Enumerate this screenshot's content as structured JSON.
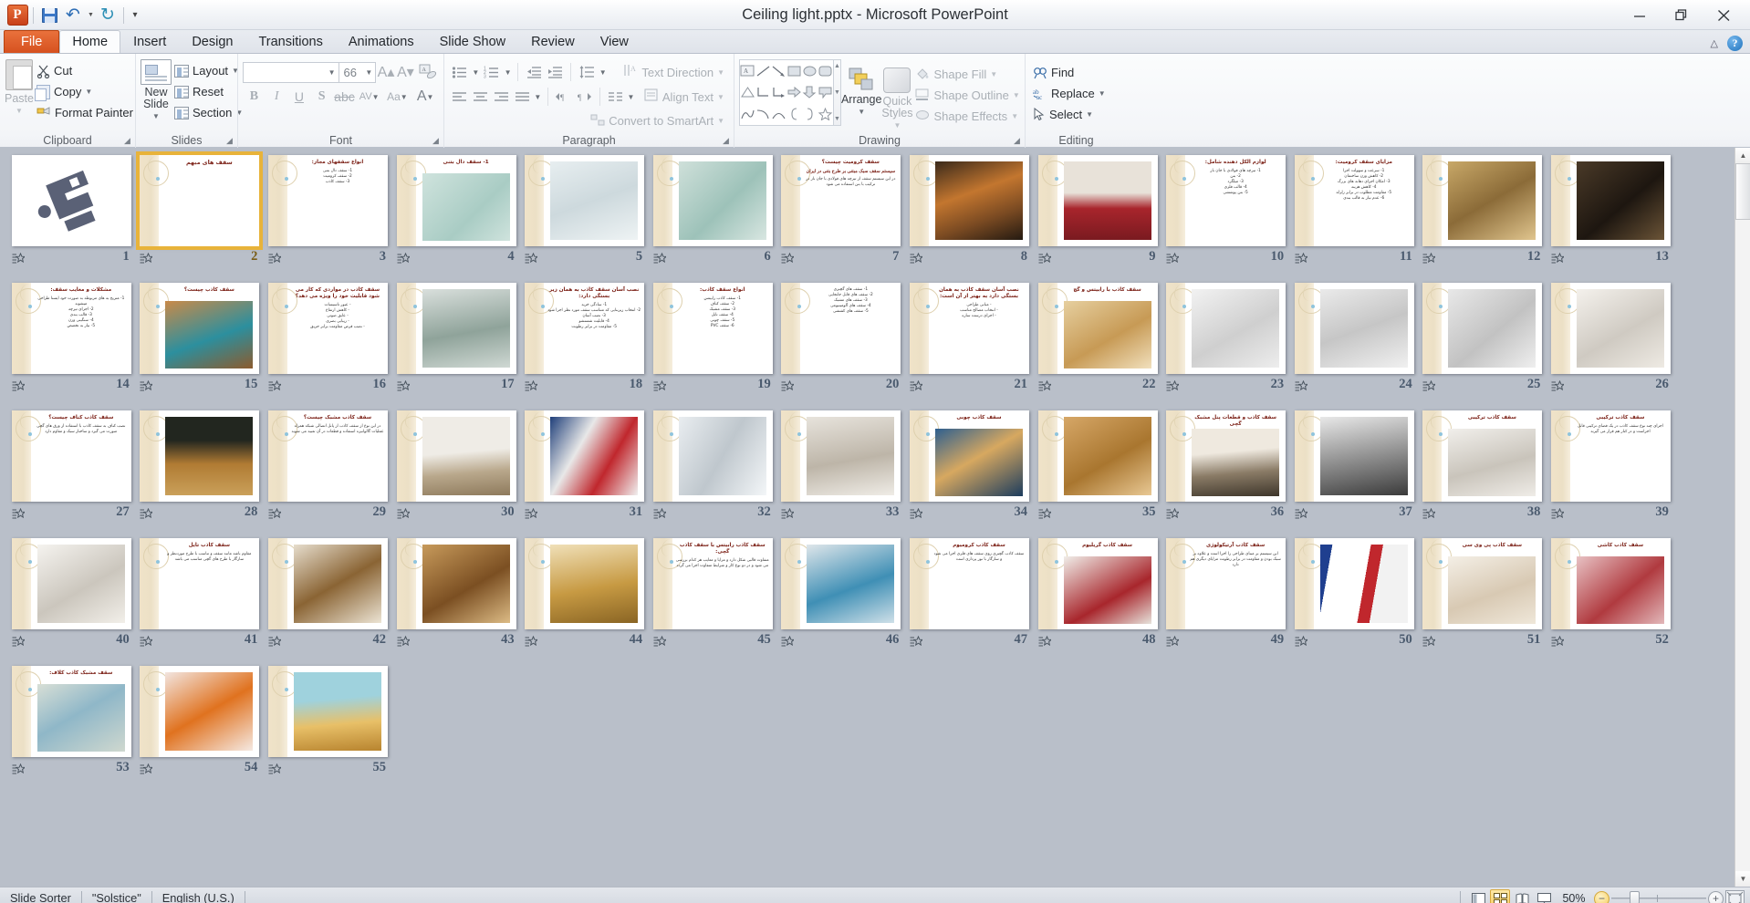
{
  "titlebar": {
    "document_title": "Ceiling light.pptx  -  Microsoft PowerPoint",
    "app_logo": "powerpoint-logo",
    "qat": [
      {
        "name": "save-icon",
        "label": "Save"
      },
      {
        "name": "undo-icon",
        "label": "Undo"
      },
      {
        "name": "redo-icon",
        "label": "Redo"
      },
      {
        "name": "customize-qat-icon",
        "label": "Customize Quick Access Toolbar"
      }
    ],
    "window": {
      "minimize": "—",
      "restore": "❐",
      "close": "✕"
    }
  },
  "tabs": [
    {
      "label": "File",
      "active": false,
      "kind": "file"
    },
    {
      "label": "Home",
      "active": true
    },
    {
      "label": "Insert",
      "active": false
    },
    {
      "label": "Design",
      "active": false
    },
    {
      "label": "Transitions",
      "active": false
    },
    {
      "label": "Animations",
      "active": false
    },
    {
      "label": "Slide Show",
      "active": false
    },
    {
      "label": "Review",
      "active": false
    },
    {
      "label": "View",
      "active": false
    }
  ],
  "help": {
    "collapse_ribbon": "collapse-ribbon-icon",
    "help_label": "?"
  },
  "ribbon": {
    "groups": [
      {
        "name": "clipboard",
        "label": "Clipboard",
        "paste_label": "Paste",
        "items": [
          {
            "label": "Cut",
            "icon": "scissors-icon",
            "dim": false,
            "caret": false
          },
          {
            "label": "Copy",
            "icon": "copy-icon",
            "dim": false,
            "caret": true
          },
          {
            "label": "Format Painter",
            "icon": "format-painter-icon",
            "dim": false,
            "caret": false
          }
        ]
      },
      {
        "name": "slides",
        "label": "Slides",
        "new_slide_label": "New\nSlide",
        "new_slide_line1": "New",
        "new_slide_line2": "Slide",
        "items": [
          {
            "label": "Layout",
            "icon": "layout-icon",
            "caret": true
          },
          {
            "label": "Reset",
            "icon": "reset-icon",
            "caret": false
          },
          {
            "label": "Section",
            "icon": "section-icon",
            "caret": true
          }
        ]
      },
      {
        "name": "font",
        "label": "Font",
        "font_name_value": "",
        "font_size_value": "66",
        "buttons": [
          "bold",
          "italic",
          "underline",
          "shadow",
          "strikethrough",
          "character-spacing",
          "change-case",
          "font-color",
          "grow-font",
          "shrink-font",
          "clear-formatting"
        ]
      },
      {
        "name": "paragraph",
        "label": "Paragraph",
        "items": [
          {
            "label": "Text Direction",
            "icon": "text-direction-icon",
            "dim": true,
            "caret": true
          },
          {
            "label": "Align Text",
            "icon": "align-text-icon",
            "dim": true,
            "caret": true
          },
          {
            "label": "Convert to SmartArt",
            "icon": "smartart-icon",
            "dim": true,
            "caret": true
          }
        ]
      },
      {
        "name": "drawing",
        "label": "Drawing",
        "arrange_label": "Arrange",
        "quick_styles_line1": "Quick",
        "quick_styles_line2": "Styles",
        "items": [
          {
            "label": "Shape Fill",
            "icon": "shape-fill-icon",
            "dim": true,
            "caret": true
          },
          {
            "label": "Shape Outline",
            "icon": "shape-outline-icon",
            "dim": true,
            "caret": true
          },
          {
            "label": "Shape Effects",
            "icon": "shape-effects-icon",
            "dim": true,
            "caret": true
          }
        ]
      },
      {
        "name": "editing",
        "label": "Editing",
        "items": [
          {
            "label": "Find",
            "icon": "find-icon",
            "dim": false,
            "caret": false
          },
          {
            "label": "Replace",
            "icon": "replace-icon",
            "dim": false,
            "caret": true
          },
          {
            "label": "Select",
            "icon": "select-icon",
            "dim": false,
            "caret": true
          }
        ]
      }
    ]
  },
  "statusbar": {
    "view_name": "Slide Sorter",
    "theme_name": "\"Solstice\"",
    "language": "English (U.S.)",
    "zoom_level": "50%",
    "views": [
      {
        "name": "normal-view-button",
        "active": false
      },
      {
        "name": "slide-sorter-view-button",
        "active": true
      },
      {
        "name": "reading-view-button",
        "active": false
      },
      {
        "name": "slide-show-button",
        "active": false
      }
    ],
    "zoom_out": "−",
    "zoom_in": "+",
    "fit_to_window": "fit-slide-to-window-icon"
  },
  "sorter": {
    "selected_slide": 2,
    "columns": 11,
    "slides": [
      {
        "n": 1,
        "kind": "image",
        "no_band": true,
        "img": "logo",
        "title": ""
      },
      {
        "n": 2,
        "kind": "title",
        "title": "سقف های مبهم",
        "body": []
      },
      {
        "n": 3,
        "kind": "list",
        "title": "انواع سقفهای مجاز:",
        "body": [
          "1- سقف دال بتنی",
          "2- سقف کرومیت",
          "3- سقف کاذب"
        ]
      },
      {
        "n": 4,
        "kind": "image",
        "title": "1- سقف دال بتنی",
        "img": "diagram-green"
      },
      {
        "n": 5,
        "kind": "image",
        "title": "",
        "img": "diagram-blue"
      },
      {
        "n": 6,
        "kind": "image",
        "title": "",
        "img": "diagram-teal"
      },
      {
        "n": 7,
        "kind": "text",
        "title": "سقف کرومیت چیست؟",
        "subtitle": "سیستم سقف سبک مبتنی بر طرح بتنی در ایران",
        "body": [
          "در این سیستم سقف از تیرچه های فولادی با جان باز در ترکیب با بتن استفاده می شود"
        ]
      },
      {
        "n": 8,
        "kind": "image",
        "title": "",
        "img": "corridor-wood"
      },
      {
        "n": 9,
        "kind": "image",
        "title": "",
        "img": "hall-red"
      },
      {
        "n": 10,
        "kind": "list",
        "title": "لوازم الکل دهنده شامل:",
        "body": [
          "1- تیرچه های فولادی با جان باز",
          "2- بتن",
          "3- میلگرد",
          "4- قالب فلزی",
          "5- بتن پوششی"
        ]
      },
      {
        "n": 11,
        "kind": "list",
        "title": "مزایای سقف کرومیت:",
        "body": [
          "1- سرعت و سهولت اجرا",
          "2- کاهش وزن ساختمان",
          "3- امکان اجرای دهانه های بزرگ",
          "4- کاهش هزینه",
          "5- مقاومت مطلوب در برابر زلزله",
          "6- عدم نیاز به قالب بندی"
        ]
      },
      {
        "n": 12,
        "kind": "image",
        "title": "",
        "img": "ceiling-gold"
      },
      {
        "n": 13,
        "kind": "image",
        "title": "",
        "img": "ceiling-dark"
      },
      {
        "n": 14,
        "kind": "list",
        "title": "مشکلات و معایب سقف:",
        "body": [
          "1- متریح به های مربوطه به صورت خود ایستا طراحی میشوند",
          "2- اجرای تیرچه",
          "3- قالب بندی",
          "4- سنگینی وزن",
          "5- نیاز به تخصص"
        ]
      },
      {
        "n": 15,
        "kind": "image",
        "title": "سقف کاذب چیست؟",
        "img": "ceiling-teal-light"
      },
      {
        "n": 16,
        "kind": "text",
        "title": "سقف کاذب در مواردی که کار می شود قابلیت خود را ویژه می دهد؟",
        "body": [
          "- عبور تاسیسات",
          "- کاهش ارتفاع",
          "- عایق صوتی",
          "- زیبایی بصری",
          "- نصب قرص مقاومت برابر حریق"
        ]
      },
      {
        "n": 17,
        "kind": "image",
        "title": "",
        "img": "room-glass"
      },
      {
        "n": 18,
        "kind": "text",
        "title": "نصب آسان سقف کاذب به همان زیر بستگی دارد:",
        "body": [
          "1- سادگی خرید",
          "2- انتخاب زیربنایی که متناسب سقف مورد نظر اجرا شود",
          "3- نصب آسان",
          "4- قابلیت شستشو",
          "5- مقاومت در برابر رطوبت"
        ]
      },
      {
        "n": 19,
        "kind": "list",
        "title": "انواع سقف کاذب:",
        "body": [
          "1- سقف کاذب رابیتس",
          "2- سقف کناف",
          "3- سقف مشبک",
          "4- سقف تایل",
          "5- سقف چوبی",
          "6- سقف PVC"
        ]
      },
      {
        "n": 20,
        "kind": "list",
        "title": "",
        "body": [
          "1- سقف های گچبری",
          "2- سقف های قابل جابجایی",
          "3- سقف های مشبک",
          "4- سقف های آلومینیومی",
          "5- سقف های کششی"
        ]
      },
      {
        "n": 21,
        "kind": "text",
        "title": "نصب آسان سقف کاذب به همان بستگی دارد به بهتر از آن است:",
        "body": [
          "- مبانی طراحی",
          "- انتخاب مصالح مناسب",
          "- اجرای درست سازه"
        ]
      },
      {
        "n": 22,
        "kind": "image",
        "title": "سقف کاذب با رابیتس و گچ",
        "img": "ceiling-curve-warm"
      },
      {
        "n": 23,
        "kind": "image",
        "title": "",
        "img": "ceiling-white-1"
      },
      {
        "n": 24,
        "kind": "image",
        "title": "",
        "img": "ceiling-white-2"
      },
      {
        "n": 25,
        "kind": "image",
        "title": "",
        "img": "ceiling-white-3"
      },
      {
        "n": 26,
        "kind": "image",
        "title": "",
        "img": "ceiling-white-4"
      },
      {
        "n": 27,
        "kind": "text",
        "title": "سقف کاذب کناف چیست؟",
        "body": [
          "نصب کناف به سقف کاذب با استفاده از ورق های گچی صورت می گیرد و ساختار سبک و مقاوم دارد"
        ]
      },
      {
        "n": 28,
        "kind": "image",
        "title": "",
        "img": "hall-wood-lights"
      },
      {
        "n": 29,
        "kind": "text",
        "title": "سقف کاذب مشبک چیست؟",
        "body": [
          "در این نوع از سقف کاذب از پانل اتصالی شبکه همراه عملیات گالوانیزه استفاده و قطعات در آن تعبیه می شوند"
        ]
      },
      {
        "n": 30,
        "kind": "image",
        "title": "",
        "img": "hall-conference"
      },
      {
        "n": 31,
        "kind": "image",
        "title": "",
        "img": "panels-color"
      },
      {
        "n": 32,
        "kind": "image",
        "title": "",
        "img": "panels-white"
      },
      {
        "n": 33,
        "kind": "image",
        "title": "",
        "img": "corridor-light"
      },
      {
        "n": 34,
        "kind": "image",
        "title": "سقف کاذب چوبی",
        "img": "office-blue"
      },
      {
        "n": 35,
        "kind": "image",
        "title": "",
        "img": "ceiling-wood-slat"
      },
      {
        "n": 36,
        "kind": "image",
        "title": "سقف کاذب و قطعات پنل مشبک گچی",
        "img": "hall-crowd"
      },
      {
        "n": 37,
        "kind": "image",
        "title": "",
        "img": "ceiling-gray-dark"
      },
      {
        "n": 38,
        "kind": "image",
        "title": "سقف کاذب ترکیبی",
        "img": "lobby-white"
      },
      {
        "n": 39,
        "kind": "text",
        "title": "سقف کاذب ترکیبی",
        "body": [
          "اجرای چند نوع سقف کاذب در یک فضای ترکیبی قابل اجراست و در کنار هم قرار می گیرند"
        ]
      },
      {
        "n": 40,
        "kind": "image",
        "title": "",
        "img": "ceiling-white-dome"
      },
      {
        "n": 41,
        "kind": "text",
        "title": "سقف کاذب تایل",
        "body": [
          "مقاوم باشد مانند سقف و تناسب با طرح موردنظر و سازگار با طرح های گچی مناسب می باشد"
        ]
      },
      {
        "n": 42,
        "kind": "image",
        "title": "",
        "img": "ceiling-round-wood"
      },
      {
        "n": 43,
        "kind": "image",
        "title": "",
        "img": "ceiling-wood-brown"
      },
      {
        "n": 44,
        "kind": "image",
        "title": "",
        "img": "hall-gold"
      },
      {
        "n": 45,
        "kind": "text",
        "title": "سقف کاذب رابیتس با سقف کاذب گچی:",
        "body": [
          "متفاوت قالبی شکل دارد و مزایا و معایب هر کدام بررسی می شود و در دو نوع کار و شرایط متفاوت اجرا می گردد"
        ]
      },
      {
        "n": 46,
        "kind": "image",
        "title": "",
        "img": "pool-dome"
      },
      {
        "n": 47,
        "kind": "text",
        "title": "سقف کاذب کرومیوم",
        "body": [
          "سقف کاذب گچبری روی سقف های فلزی اجرا می شود و سازگار با نور پردازی است"
        ]
      },
      {
        "n": 48,
        "kind": "image",
        "title": "سقف کاذب گریلیوم",
        "img": "ceiling-red-grid"
      },
      {
        "n": 49,
        "kind": "text",
        "title": "سقف کاذب آرتیکولوژی",
        "body": [
          "این سیستم بر مبنای طراحی را اجرا است و علاوه بر سبک بودن و مقاومت در برابر رطوبت مزایای دیگری هم دارد"
        ]
      },
      {
        "n": 50,
        "kind": "image",
        "title": "",
        "img": "panel-stripe"
      },
      {
        "n": 51,
        "kind": "image",
        "title": "سقف کاذب پی وی سی",
        "img": "ceiling-pvc"
      },
      {
        "n": 52,
        "kind": "image",
        "title": "سقف کاذب کاشی",
        "img": "ceiling-tile-red"
      },
      {
        "n": 53,
        "kind": "image",
        "title": "سقف مشبک کاذب کلاف:",
        "img": "ceiling-lights-color"
      },
      {
        "n": 54,
        "kind": "image",
        "title": "",
        "img": "ceiling-orange-ring"
      },
      {
        "n": 55,
        "kind": "image",
        "title": "",
        "img": "mall-atrium"
      }
    ]
  }
}
